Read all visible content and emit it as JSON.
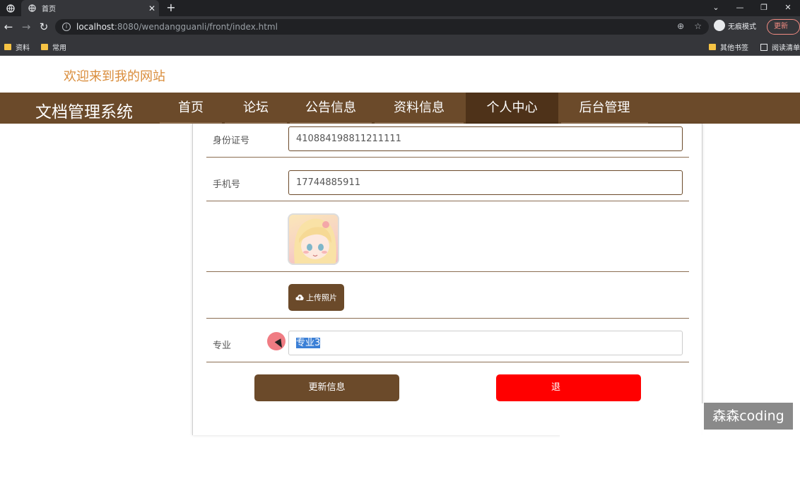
{
  "browser": {
    "tab_title": "首页",
    "url_host": "localhost",
    "url_rest": ":8080/wendangguanli/front/index.html",
    "incognito_label": "无痕模式",
    "update_label": "更新",
    "bookmarks": [
      "资料",
      "常用"
    ],
    "bookmarks_right": [
      "其他书签",
      "阅读清单"
    ]
  },
  "site": {
    "welcome": "欢迎来到我的网站",
    "brand": "文档管理系统",
    "nav": [
      "首页",
      "论坛",
      "公告信息",
      "资料信息",
      "个人中心",
      "后台管理"
    ],
    "active_nav": "个人中心"
  },
  "form": {
    "id_label": "身份证号",
    "id_value": "410884198811211111",
    "phone_label": "手机号",
    "phone_value": "17744885911",
    "upload_label": "上传照片",
    "major_label": "专业",
    "major_value": "专业3",
    "update_button": "更新信息",
    "logout_button": "退"
  },
  "watermark": "森森coding",
  "colors": {
    "primary": "#6b4a2a",
    "active_nav": "#4e3219",
    "danger": "#ff0000",
    "welcome": "#d98c3a"
  }
}
